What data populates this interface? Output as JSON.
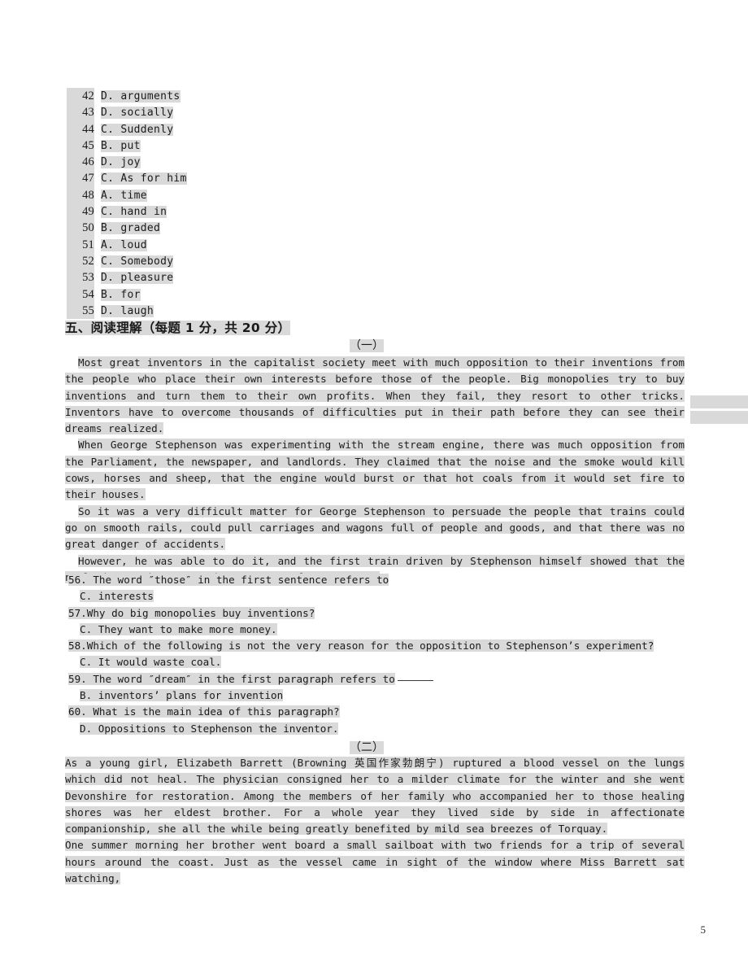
{
  "document": {
    "page_number": "5",
    "highlight_color": "#d9d9d9",
    "text_color": "#1a1a1a"
  },
  "answer_key": {
    "rows": [
      {
        "number": "42",
        "answer": "D. arguments"
      },
      {
        "number": "43",
        "answer": "D. socially"
      },
      {
        "number": "44",
        "answer": "C. Suddenly"
      },
      {
        "number": "45",
        "answer": "B. put"
      },
      {
        "number": "46",
        "answer": "D. joy"
      },
      {
        "number": "47",
        "answer": "C. As for him"
      },
      {
        "number": "48",
        "answer": "A. time"
      },
      {
        "number": "49",
        "answer": "C. hand in"
      },
      {
        "number": "50",
        "answer": "B. graded"
      },
      {
        "number": "51",
        "answer": "A. loud"
      },
      {
        "number": "52",
        "answer": "C. Somebody"
      },
      {
        "number": "53",
        "answer": "D. pleasure"
      },
      {
        "number": "54",
        "answer": "B. for"
      },
      {
        "number": "55",
        "answer": "D. laugh"
      }
    ]
  },
  "section": {
    "heading": "五、阅读理解（每题 1 分，共 20 分）"
  },
  "part_one": {
    "label": "（一）",
    "paragraphs": [
      "Most great inventors in the capitalist society meet with much opposition to their inventions from the people who place their own interests before those of the people. Big monopolies try to buy inventions and turn them to their own profits. When they fail, they resort to other tricks. Inventors have to overcome thousands of difficulties put in their path before they can see their dreams realized.",
      "When George Stephenson was experimenting with the stream engine, there was much opposition from the Parliament, the newspaper, and landlords. They claimed that the noise and the smoke would kill cows, horses and sheep, that the engine would burst or that hot coals from it would set fire to their houses.",
      "So it was a very difficult matter for George Stephenson to persuade the people that trains could go on smooth rails, could pull carriages and wagons full of people and goods, and that there was no great danger of accidents.",
      "However, he was able to do it, and the first train driven by Stephenson himself showed that the newly invented steam engine was a complete success."
    ],
    "questions": [
      {
        "stem": "56. The word ″those″ in the first sentence refers to",
        "answer": "C. interests",
        "has_blank": false
      },
      {
        "stem": "57.Why do big monopolies buy inventions?",
        "answer": "C. They want to make more money.",
        "has_blank": false
      },
      {
        "stem": "58.Which of the following is not the very reason for the opposition to Stephenson’s experiment?",
        "answer": "C. It would waste coal.",
        "has_blank": false
      },
      {
        "stem": "59. The word ″dream″ in the first paragraph refers to",
        "answer": "B. inventors’ plans for invention",
        "has_blank": true
      },
      {
        "stem": "60. What is the main idea of this paragraph?",
        "answer": "D. Oppositions to Stephenson the inventor.",
        "has_blank": false
      }
    ]
  },
  "part_two": {
    "label": "（二）",
    "paragraphs": [
      "As a young girl, Elizabeth Barrett (Browning 英国作家勃朗宁) ruptured a blood vessel on the lungs which did not heal. The physician consigned her to a milder climate for the winter and she went Devonshire for restoration. Among the members of her family who accompanied her to those healing shores was her eldest brother. For a whole year they lived side by side in affectionate companionship, she all the while being greatly benefited by mild sea breezes of Torquay.",
      "One summer morning her brother went board a small sailboat with two friends for a trip of several hours around the coast. Just as the vessel came in sight of the window where Miss Barrett sat watching,"
    ]
  }
}
